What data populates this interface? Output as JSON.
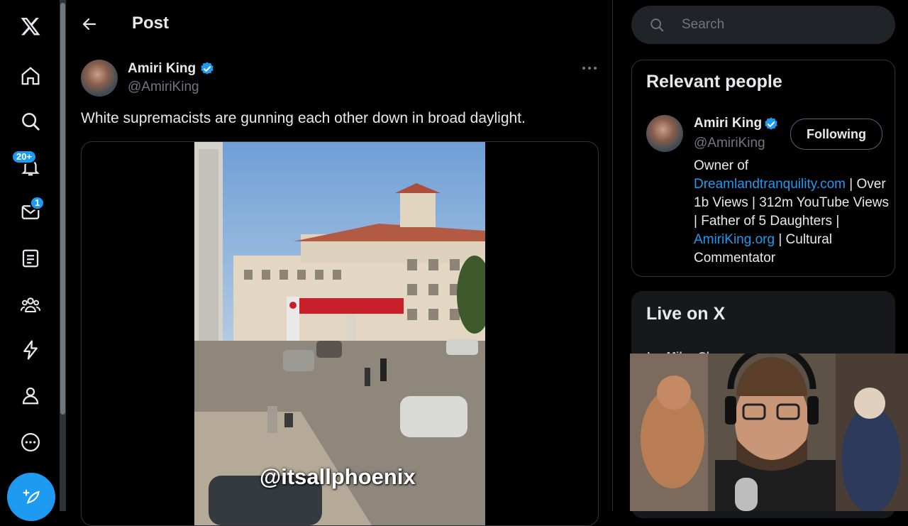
{
  "nav": {
    "items": [
      {
        "name": "home-icon",
        "label": "Home"
      },
      {
        "name": "explore-icon",
        "label": "Explore"
      },
      {
        "name": "notifications-icon",
        "label": "Notifications"
      },
      {
        "name": "messages-icon",
        "label": "Messages"
      },
      {
        "name": "lists-icon",
        "label": "Lists"
      },
      {
        "name": "communities-icon",
        "label": "Communities"
      },
      {
        "name": "premium-icon",
        "label": "Premium"
      },
      {
        "name": "profile-icon",
        "label": "Profile"
      },
      {
        "name": "more-icon",
        "label": "More"
      }
    ],
    "notifications_badge": "20+",
    "messages_badge": "1"
  },
  "header": {
    "title": "Post"
  },
  "post": {
    "author_name": "Amiri King",
    "author_handle": "@AmiriKing",
    "text": "White supremacists are gunning each other down in broad daylight.",
    "video_watermark": "@itsallphoenix"
  },
  "search": {
    "placeholder": "Search"
  },
  "relevant_people": {
    "title": "Relevant people",
    "person": {
      "name": "Amiri King",
      "handle": "@AmiriKing",
      "follow_label": "Following",
      "bio_1": "Owner of ",
      "bio_link_1": "Dreamlandtranquility.com",
      "bio_2": " | Over 1b Views | 312m YouTube Views | Father of 5 Daughters | ",
      "bio_link_2": "AmiriKing.org",
      "bio_3": " | Cultural Commentator"
    }
  },
  "live": {
    "title": "Live on X",
    "first_row": "Ian Miles Cheong"
  },
  "colors": {
    "accent": "#1d9bf0",
    "background": "#000000",
    "text": "#e7e9ea",
    "muted": "#71767b",
    "border": "#2f3336"
  }
}
